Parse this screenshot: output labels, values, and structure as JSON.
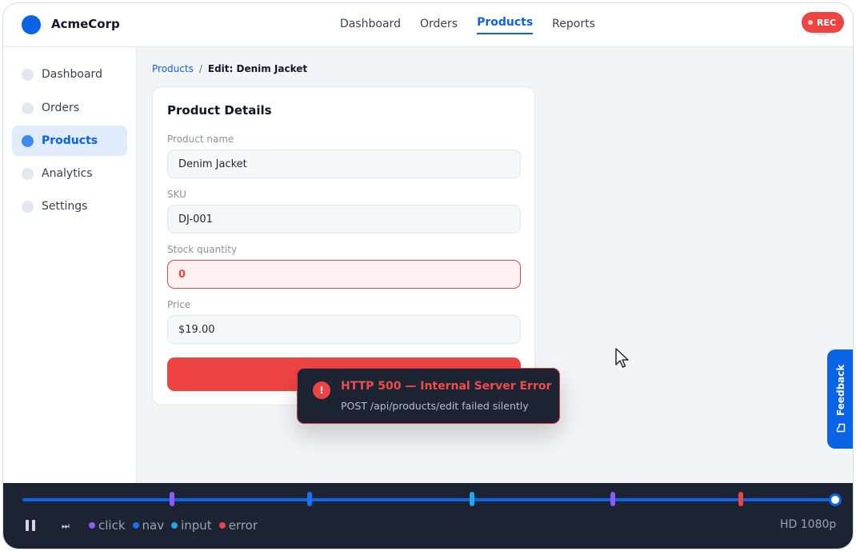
{
  "app": {
    "brand": "AcmeCorp"
  },
  "topnav": {
    "items": [
      {
        "label": "Dashboard",
        "active": false
      },
      {
        "label": "Orders",
        "active": false
      },
      {
        "label": "Products",
        "active": true
      },
      {
        "label": "Reports",
        "active": false
      }
    ]
  },
  "recording": {
    "badge": "REC",
    "color": "#ef4444"
  },
  "sidebar": {
    "items": [
      {
        "label": "Dashboard",
        "active": false
      },
      {
        "label": "Orders",
        "active": false
      },
      {
        "label": "Products",
        "active": true
      },
      {
        "label": "Analytics",
        "active": false
      },
      {
        "label": "Settings",
        "active": false
      }
    ]
  },
  "breadcrumb": {
    "parent": "Products",
    "separator": "/",
    "current": "Edit: Denim Jacket"
  },
  "form": {
    "title": "Product Details",
    "fields": {
      "name": {
        "label": "Product name",
        "value": "Denim Jacket"
      },
      "sku": {
        "label": "SKU",
        "value": "DJ-001"
      },
      "stock": {
        "label": "Stock quantity",
        "value": "0",
        "state": "error"
      },
      "price": {
        "label": "Price",
        "value": "$19.00"
      }
    },
    "submit_button": {
      "color": "#ef4444"
    }
  },
  "toast": {
    "icon": "alert-icon",
    "icon_glyph": "!",
    "title": "HTTP 500 — Internal Server Error",
    "message": "POST /api/products/edit failed silently"
  },
  "feedback_tab": {
    "label": "Feedback",
    "icon": "message-square-icon"
  },
  "player": {
    "progress": 1.0,
    "events": [
      {
        "type": "click",
        "at": 0.184
      },
      {
        "type": "nav",
        "at": 0.354
      },
      {
        "type": "input",
        "at": 0.554
      },
      {
        "type": "click",
        "at": 0.727
      },
      {
        "type": "error",
        "at": 0.885
      }
    ],
    "legend": [
      {
        "label": "click",
        "color": "#8b5cf6"
      },
      {
        "label": "nav",
        "color": "#1d6ff2"
      },
      {
        "label": "input",
        "color": "#22a7e8"
      },
      {
        "label": "error",
        "color": "#ef4444"
      }
    ],
    "quality": "HD 1080p"
  }
}
